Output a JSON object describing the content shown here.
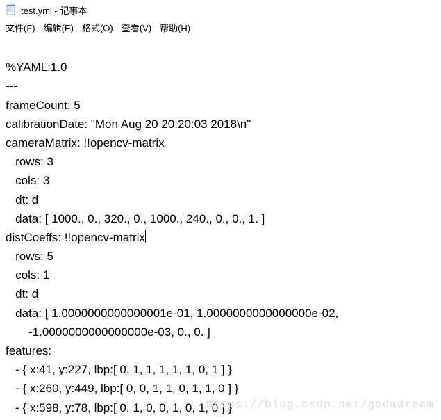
{
  "window": {
    "filename": "test.yml",
    "appname": "记事本",
    "title_separator": " - "
  },
  "menu": {
    "file": "文件(F)",
    "edit": "编辑(E)",
    "format": "格式(O)",
    "view": "查看(V)",
    "help": "帮助(H)"
  },
  "content": {
    "line1": "%YAML:1.0",
    "line2": "---",
    "line3": "frameCount: 5",
    "line4": "calibrationDate: \"Mon Aug 20 20:20:03 2018\\n\"",
    "line5": "cameraMatrix: !!opencv-matrix",
    "line6": "   rows: 3",
    "line7": "   cols: 3",
    "line8": "   dt: d",
    "line9": "   data: [ 1000., 0., 320., 0., 1000., 240., 0., 0., 1. ]",
    "line10": "distCoeffs: !!opencv-matrix",
    "line11": "   rows: 5",
    "line12": "   cols: 1",
    "line13": "   dt: d",
    "line14": "   data: [ 1.0000000000000001e-01, 1.0000000000000000e-02,",
    "line15": "       -1.0000000000000000e-03, 0., 0. ]",
    "line16": "features:",
    "line17": "   - { x:41, y:227, lbp:[ 0, 1, 1, 1, 1, 1, 0, 1 ] }",
    "line18": "   - { x:260, y:449, lbp:[ 0, 0, 1, 1, 0, 1, 1, 0 ] }",
    "line19": "   - { x:598, y:78, lbp:[ 0, 1, 0, 0, 1, 0, 1, 0 ] }"
  },
  "watermark": "https://blog.csdn.net/godadream"
}
